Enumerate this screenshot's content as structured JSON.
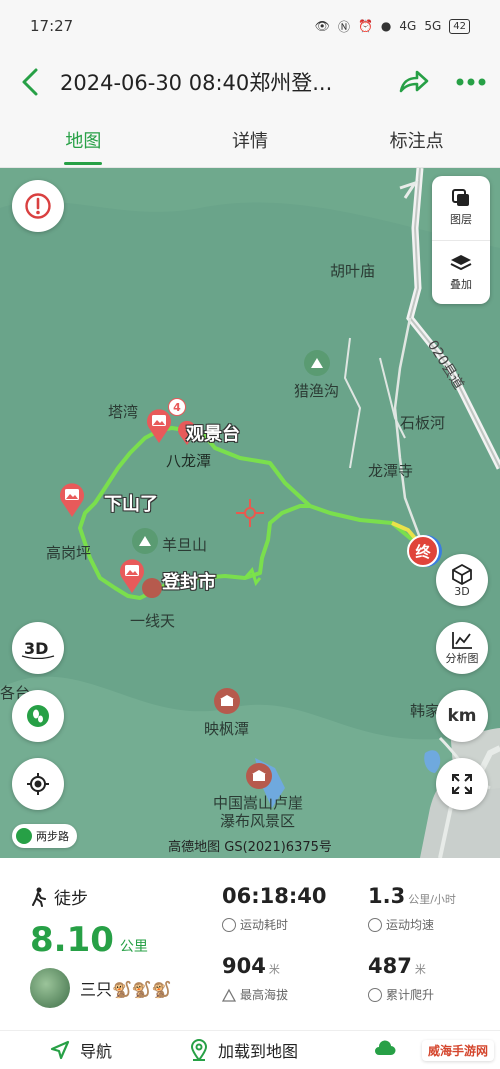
{
  "status_bar": {
    "time": "17:27",
    "signal": "4G",
    "signal2": "5G",
    "battery": "42"
  },
  "header": {
    "title": "2024-06-30 08:40郑州登...",
    "colors": {
      "accent": "#27a046"
    }
  },
  "tabs": [
    {
      "label": "地图",
      "active": true
    },
    {
      "label": "详情",
      "active": false
    },
    {
      "label": "标注点",
      "active": false
    }
  ],
  "map": {
    "layer_panel": {
      "layers_label": "图层",
      "overlay_label": "叠加"
    },
    "places": {
      "hutou": "胡叶庙",
      "lieyu": "猎渔沟",
      "shiban": "石板河",
      "longtan": "龙潭寺",
      "road": "020县道",
      "tawan": "塔湾",
      "gaogang": "高岗坪",
      "yangdan": "羊旦山",
      "yixiantian": "一线天",
      "yingfeng": "映枫潭",
      "songshan": "中国嵩山卢崖",
      "songshan2": "瀑布风景区",
      "hanjia": "韩家",
      "left_edge": "各台"
    },
    "route_labels": {
      "guanjing": "观景台",
      "balong": "八龙潭",
      "xiashan": "下山了",
      "dengfeng": "登封市"
    },
    "markers": {
      "end": "终",
      "count": "4"
    },
    "buttons": {
      "three_d": "3D",
      "analysis": "分析图",
      "km": "km",
      "two_step": "两步路"
    },
    "attribution": "高德地图 GS(2021)6375号"
  },
  "stats": {
    "sport": "徒步",
    "distance": "8.10",
    "distance_unit": "公里",
    "user": "三只🐒🐒🐒",
    "duration": "06:18:40",
    "duration_label": "运动耗时",
    "speed": "1.3",
    "speed_unit": "公里/小时",
    "speed_label": "运动均速",
    "max_alt": "904",
    "max_alt_unit": "米",
    "max_alt_label": "最高海拔",
    "climb": "487",
    "climb_unit": "米",
    "climb_label": "累计爬升"
  },
  "bottom_bar": {
    "navigate": "导航",
    "load_map": "加载到地图"
  },
  "watermark": "威海手游网"
}
